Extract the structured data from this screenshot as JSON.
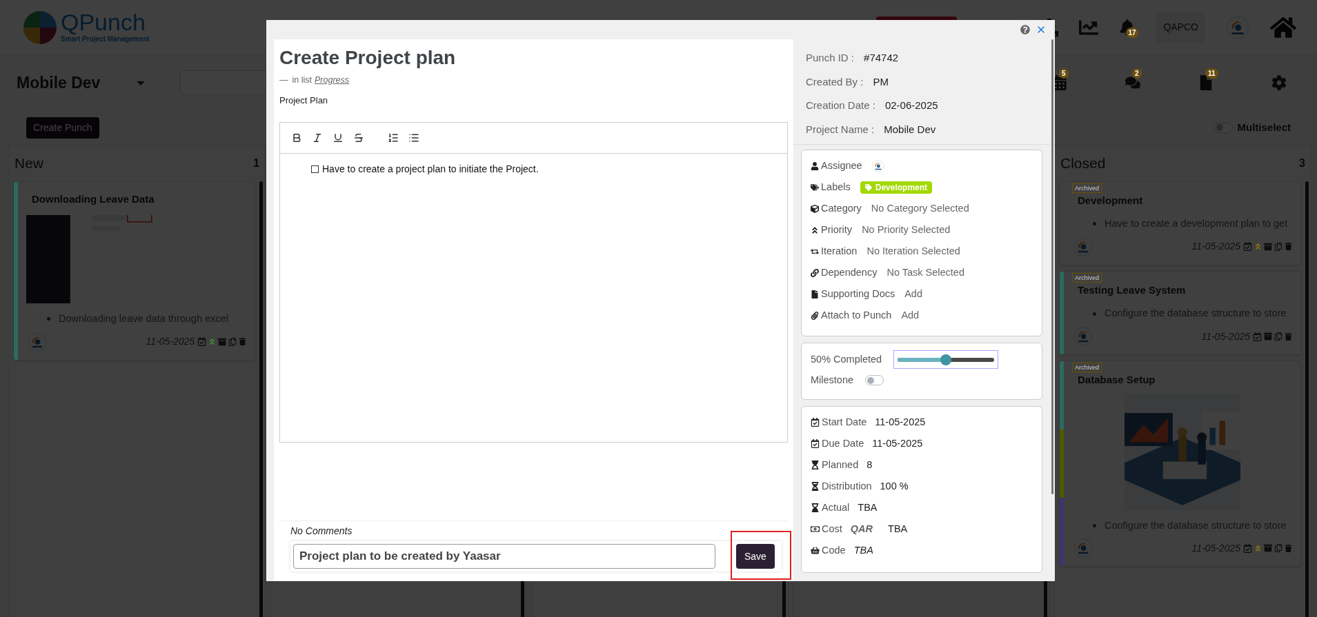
{
  "header": {
    "logo_title": "QPunch",
    "logo_subtitle": "Smart Project Management",
    "notification_count": "17",
    "org_button": "QAPCO"
  },
  "toolbar": {
    "project": "Mobile Dev",
    "shortcuts": [
      {
        "kind": "calendar",
        "count": "5"
      },
      {
        "kind": "chat",
        "count": "2"
      },
      {
        "kind": "file",
        "count": "11"
      }
    ],
    "create_button": "Create Punch",
    "multiselect": {
      "label": "Multiselect",
      "on": false
    }
  },
  "columns": [
    {
      "title": "New",
      "count": "1",
      "cards": [
        {
          "title": "Downloading Leave Data",
          "stripes": [
            {
              "color": "#2b6b60"
            }
          ],
          "media": {
            "kind": "picture"
          },
          "bullet": "Downloading leave data through excel",
          "date": "11-05-2025",
          "priority": {
            "color": "#3d8f3d"
          }
        }
      ]
    },
    {
      "title": "Closed",
      "count": "3",
      "cards": [
        {
          "badge": "Archived",
          "title": "Development",
          "bullet": "Have to create a development plan to get",
          "date": "11-05-2025",
          "priority": {
            "color": "#8c7414"
          }
        },
        {
          "badge": "Archived",
          "title": "Testing Leave System",
          "stripes": [
            {
              "color": "#2b6b60"
            }
          ],
          "bullet": "Configure the database structure to store",
          "date": "11-05-2025"
        },
        {
          "badge": "Archived",
          "title": "Database Setup",
          "stripes": [
            {
              "color": "#2b6b60"
            },
            {
              "color": "#4d5a00"
            },
            {
              "color": "#3d3570"
            }
          ],
          "media": {
            "kind": "picture"
          },
          "bullet": "Configure the database structure to store",
          "date": "11-05-2025",
          "priority": {
            "color": "#8c7414"
          }
        }
      ]
    }
  ],
  "modal": {
    "title": "Create Project plan",
    "list_dash": "—",
    "list_label": "in list",
    "list_name": "Progress",
    "description": "Project Plan",
    "editor": {
      "tools": [
        {
          "kind": "bold"
        },
        {
          "kind": "italic"
        },
        {
          "kind": "underline"
        },
        {
          "kind": "strike"
        },
        {
          "kind": "ordered"
        },
        {
          "kind": "bullet"
        }
      ],
      "items": [
        {
          "text": "Have to create a project plan to initiate the Project.",
          "checked": false
        }
      ]
    },
    "comments_label": "No Comments",
    "comment_value": "Project plan to be created by Yaasar",
    "save_button": "Save",
    "save_highlighted": true,
    "info": [
      {
        "label": "Punch ID :",
        "value": "#74742"
      },
      {
        "label": "Created By :",
        "value": "PM"
      },
      {
        "label": "Creation Date :",
        "value": "02-06-2025"
      },
      {
        "label": "Project Name :",
        "value": "Mobile Dev"
      }
    ],
    "details": [
      {
        "kind": "assignee",
        "label": "Assignee"
      },
      {
        "kind": "labels",
        "label": "Labels",
        "tag": {
          "text": "Development",
          "color": "#a3d900"
        }
      },
      {
        "kind": "category",
        "label": "Category",
        "value": "No Category Selected"
      },
      {
        "kind": "priority",
        "label": "Priority",
        "value": "No Priority Selected"
      },
      {
        "kind": "iteration",
        "label": "Iteration",
        "value": "No Iteration Selected"
      },
      {
        "kind": "dependency",
        "label": "Dependency",
        "value": "No Task Selected"
      },
      {
        "kind": "docs",
        "label": "Supporting Docs",
        "value": "Add"
      },
      {
        "kind": "attach",
        "label": "Attach to Punch",
        "value": "Add"
      }
    ],
    "progress": {
      "label": "50% Completed",
      "level": 0.5
    },
    "milestone": {
      "label": "Milestone",
      "on": false
    },
    "schedule": [
      {
        "kind": "start",
        "label": "Start Date",
        "value": "11-05-2025"
      },
      {
        "kind": "due",
        "label": "Due Date",
        "value": "11-05-2025"
      },
      {
        "kind": "planned",
        "label": "Planned",
        "value": "8"
      },
      {
        "kind": "distribution",
        "label": "Distribution",
        "value": "100 %"
      },
      {
        "kind": "actual",
        "label": "Actual",
        "value": "TBA"
      },
      {
        "kind": "cost",
        "label": "Cost",
        "currency": "QAR",
        "value": "TBA"
      },
      {
        "kind": "code",
        "label": "Code",
        "value": "TBA",
        "italic": true
      }
    ]
  }
}
